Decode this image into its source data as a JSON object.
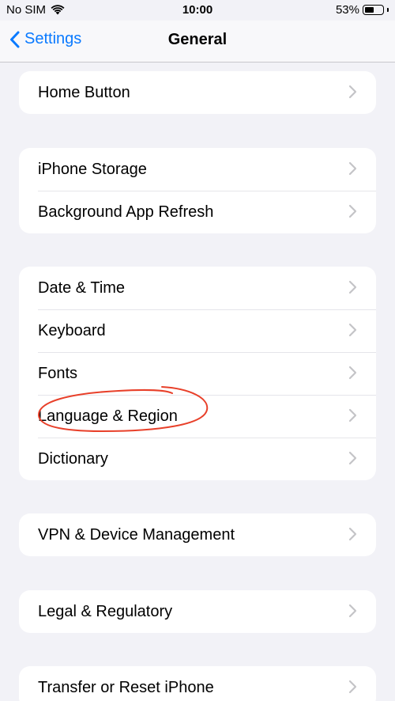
{
  "status_bar": {
    "carrier": "No SIM",
    "time": "10:00",
    "battery_percent": "53%",
    "battery_level": 0.53,
    "wifi_icon": "wifi-icon",
    "battery_icon": "battery-icon"
  },
  "nav": {
    "back_label": "Settings",
    "title": "General",
    "back_icon": "chevron-left-icon",
    "accent_color": "#0a7aff"
  },
  "groups": [
    {
      "items": [
        {
          "label": "Home Button"
        }
      ]
    },
    {
      "items": [
        {
          "label": "iPhone Storage"
        },
        {
          "label": "Background App Refresh"
        }
      ]
    },
    {
      "items": [
        {
          "label": "Date & Time"
        },
        {
          "label": "Keyboard"
        },
        {
          "label": "Fonts"
        },
        {
          "label": "Language & Region"
        },
        {
          "label": "Dictionary"
        }
      ]
    },
    {
      "items": [
        {
          "label": "VPN & Device Management"
        }
      ]
    },
    {
      "items": [
        {
          "label": "Legal & Regulatory"
        }
      ]
    },
    {
      "items": [
        {
          "label": "Transfer or Reset iPhone"
        }
      ]
    }
  ],
  "annotation": {
    "shape": "hand-drawn ellipse",
    "color": "#e8402a",
    "target": "Language & Region"
  },
  "row_chevron_icon": "chevron-right-icon"
}
